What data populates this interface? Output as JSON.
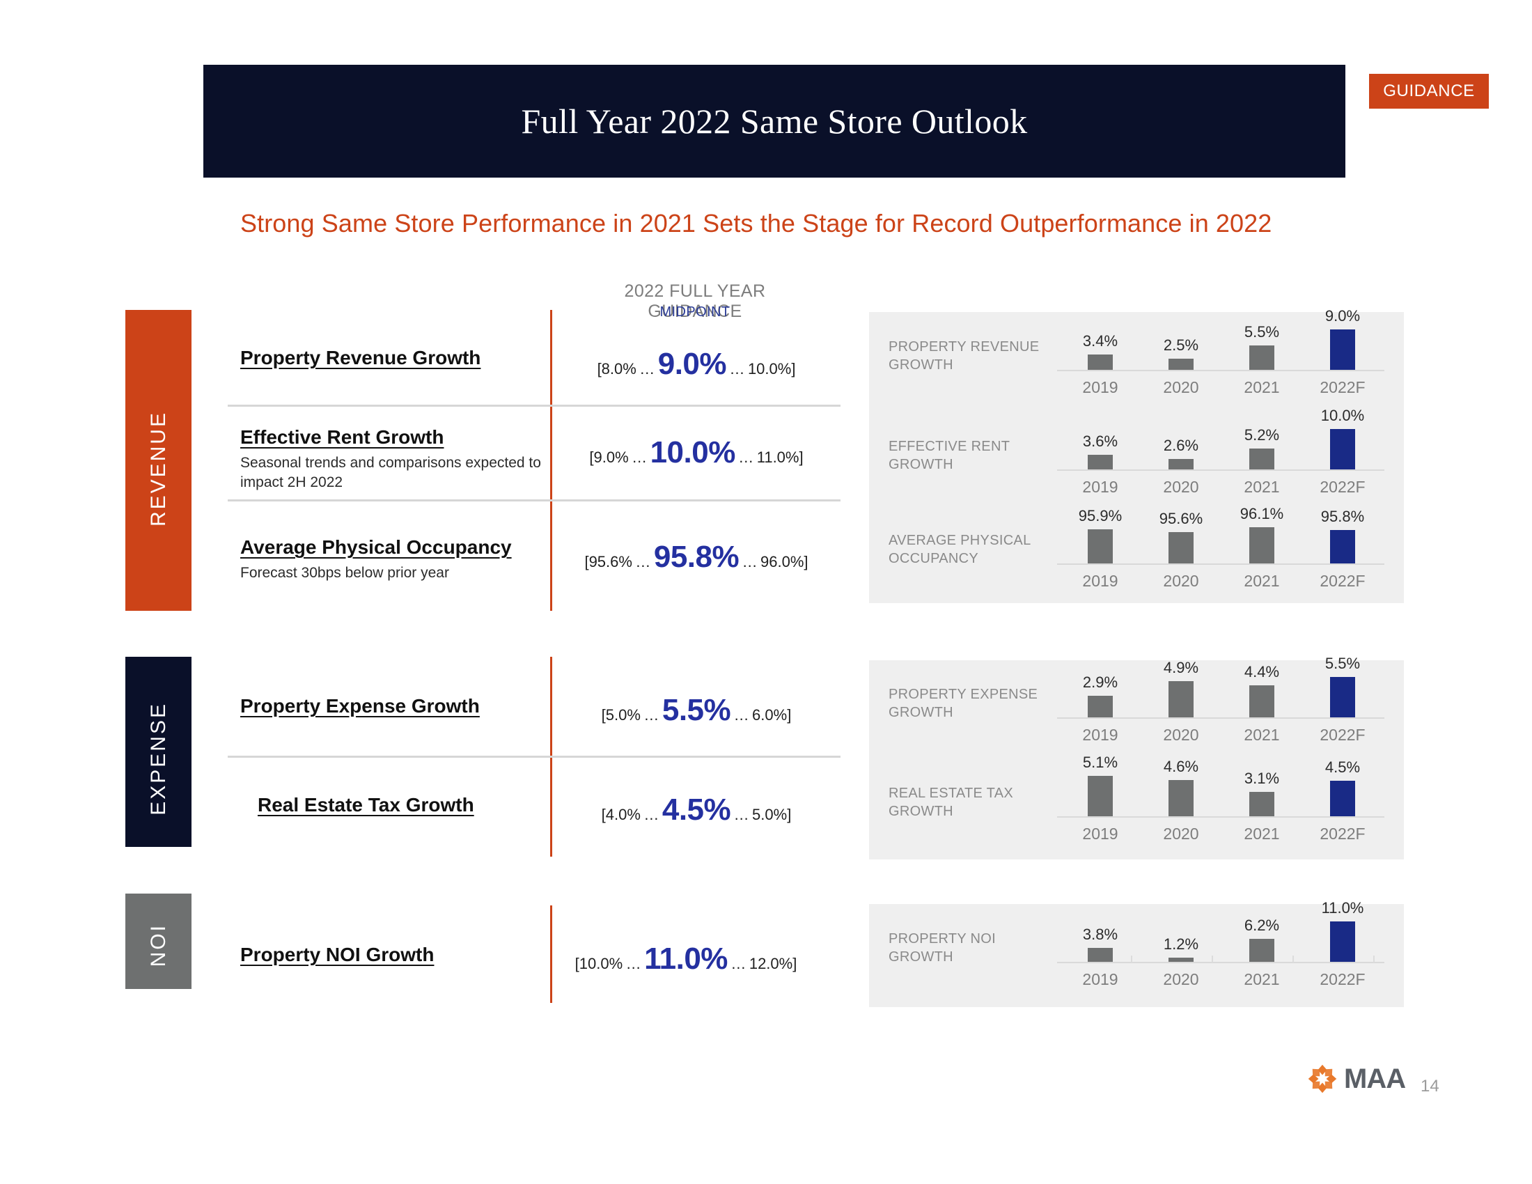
{
  "header": {
    "title": "Full Year 2022 Same Store Outlook",
    "badge": "GUIDANCE",
    "subheadline": "Strong Same Store Performance in 2021 Sets the Stage for Record Outperformance in 2022"
  },
  "guidance_column": {
    "title": "2022 FULL YEAR GUIDANCE",
    "subtitle": "MIDPOINT"
  },
  "sections": [
    {
      "key": "revenue",
      "label": "REVENUE",
      "color": "#cc4318"
    },
    {
      "key": "expense",
      "label": "EXPENSE",
      "color": "#0a1029"
    },
    {
      "key": "noi",
      "label": "NOI",
      "color": "#6e7070"
    }
  ],
  "metrics": [
    {
      "title": "Property Revenue Growth",
      "sub": "",
      "low": "[8.0%",
      "dots1": "…",
      "mid": "9.0%",
      "dots2": "…",
      "high": "10.0%]"
    },
    {
      "title": "Effective Rent Growth",
      "sub": "Seasonal trends and comparisons expected to impact 2H 2022",
      "low": "[9.0%",
      "dots1": "…",
      "mid": "10.0%",
      "dots2": "…",
      "high": "11.0%]"
    },
    {
      "title": "Average Physical Occupancy",
      "sub": "Forecast 30bps below prior year",
      "low": "[95.6%",
      "dots1": "…",
      "mid": "95.8%",
      "dots2": "…",
      "high": "96.0%]"
    },
    {
      "title": "Property Expense Growth",
      "sub": "",
      "low": "[5.0%",
      "dots1": "…",
      "mid": "5.5%",
      "dots2": "…",
      "high": "6.0%]"
    },
    {
      "title": "Real Estate Tax Growth",
      "sub": "",
      "low": "[4.0%",
      "dots1": "…",
      "mid": "4.5%",
      "dots2": "…",
      "high": "5.0%]"
    },
    {
      "title": "Property NOI Growth",
      "sub": "",
      "low": "[10.0%",
      "dots1": "…",
      "mid": "11.0%",
      "dots2": "…",
      "high": "12.0%]"
    }
  ],
  "colors": {
    "orange": "#cc4318",
    "navy": "#0a1029",
    "grey": "#6e7070",
    "bar_blue": "#192a86",
    "midpoint_blue": "#2430a0",
    "panel_bg": "#efefef"
  },
  "footer": {
    "logo_word": "MAA",
    "page_number": "14"
  },
  "chart_data": [
    {
      "type": "bar",
      "title": "PROPERTY REVENUE GROWTH",
      "categories": [
        "2019",
        "2020",
        "2021",
        "2022F"
      ],
      "values": [
        3.4,
        2.5,
        5.5,
        9.0
      ],
      "labels": [
        "3.4%",
        "2.5%",
        "5.5%",
        "9.0%"
      ],
      "highlight_index": 3,
      "xlabel": "",
      "ylabel": "",
      "ylim": [
        0,
        9.0
      ],
      "grid": false,
      "legend": "none"
    },
    {
      "type": "bar",
      "title": "EFFECTIVE RENT GROWTH",
      "categories": [
        "2019",
        "2020",
        "2021",
        "2022F"
      ],
      "values": [
        3.6,
        2.6,
        5.2,
        10.0
      ],
      "labels": [
        "3.6%",
        "2.6%",
        "5.2%",
        "10.0%"
      ],
      "highlight_index": 3,
      "xlabel": "",
      "ylabel": "",
      "ylim": [
        0,
        10.0
      ],
      "grid": false,
      "legend": "none"
    },
    {
      "type": "bar",
      "title": "AVERAGE PHYSICAL OCCUPANCY",
      "categories": [
        "2019",
        "2020",
        "2021",
        "2022F"
      ],
      "values": [
        95.9,
        95.6,
        96.1,
        95.8
      ],
      "labels": [
        "95.9%",
        "95.6%",
        "96.1%",
        "95.8%"
      ],
      "highlight_index": 3,
      "xlabel": "",
      "ylabel": "",
      "ylim": [
        95.0,
        96.5
      ],
      "grid": false,
      "legend": "none"
    },
    {
      "type": "bar",
      "title": "PROPERTY EXPENSE GROWTH",
      "categories": [
        "2019",
        "2020",
        "2021",
        "2022F"
      ],
      "values": [
        2.9,
        4.9,
        4.4,
        5.5
      ],
      "labels": [
        "2.9%",
        "4.9%",
        "4.4%",
        "5.5%"
      ],
      "highlight_index": 3,
      "xlabel": "",
      "ylabel": "",
      "ylim": [
        0,
        5.5
      ],
      "grid": false,
      "legend": "none"
    },
    {
      "type": "bar",
      "title": "REAL ESTATE TAX GROWTH",
      "categories": [
        "2019",
        "2020",
        "2021",
        "2022F"
      ],
      "values": [
        5.1,
        4.6,
        3.1,
        4.5
      ],
      "labels": [
        "5.1%",
        "4.6%",
        "3.1%",
        "4.5%"
      ],
      "highlight_index": 3,
      "xlabel": "",
      "ylabel": "",
      "ylim": [
        0,
        5.1
      ],
      "grid": false,
      "legend": "none"
    },
    {
      "type": "bar",
      "title": "PROPERTY NOI GROWTH",
      "categories": [
        "2019",
        "2020",
        "2021",
        "2022F"
      ],
      "values": [
        3.8,
        1.2,
        6.2,
        11.0
      ],
      "labels": [
        "3.8%",
        "1.2%",
        "6.2%",
        "11.0%"
      ],
      "highlight_index": 3,
      "xlabel": "",
      "ylabel": "",
      "ylim": [
        0,
        11.0
      ],
      "grid": false,
      "legend": "none"
    }
  ]
}
